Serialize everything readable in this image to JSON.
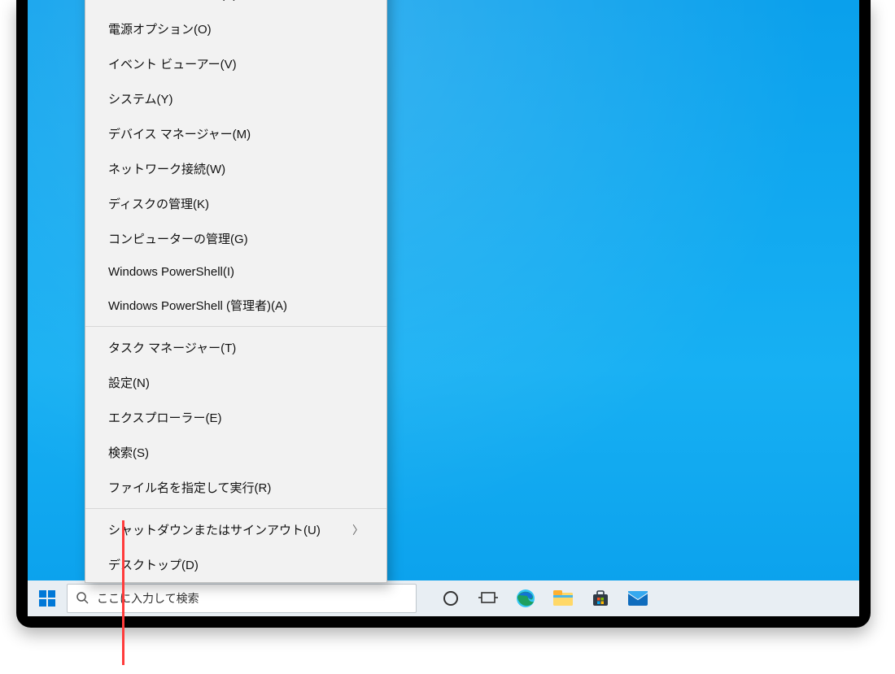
{
  "menu": {
    "groups": [
      [
        "モビリティ センター(B)",
        "電源オプション(O)",
        "イベント ビューアー(V)",
        "システム(Y)",
        "デバイス マネージャー(M)",
        "ネットワーク接続(W)",
        "ディスクの管理(K)",
        "コンピューターの管理(G)",
        "Windows PowerShell(I)",
        "Windows PowerShell (管理者)(A)"
      ],
      [
        "タスク マネージャー(T)",
        "設定(N)",
        "エクスプローラー(E)",
        "検索(S)",
        "ファイル名を指定して実行(R)"
      ],
      [
        {
          "label": "シャットダウンまたはサインアウト(U)",
          "submenu": true
        },
        "デスクトップ(D)"
      ]
    ]
  },
  "taskbar": {
    "search_placeholder": "ここに入力して検索",
    "icons": {
      "cortana": "cortana-icon",
      "taskview": "task-view-icon",
      "edge": "edge-icon",
      "explorer": "file-explorer-icon",
      "store": "store-icon",
      "mail": "mail-icon"
    }
  }
}
